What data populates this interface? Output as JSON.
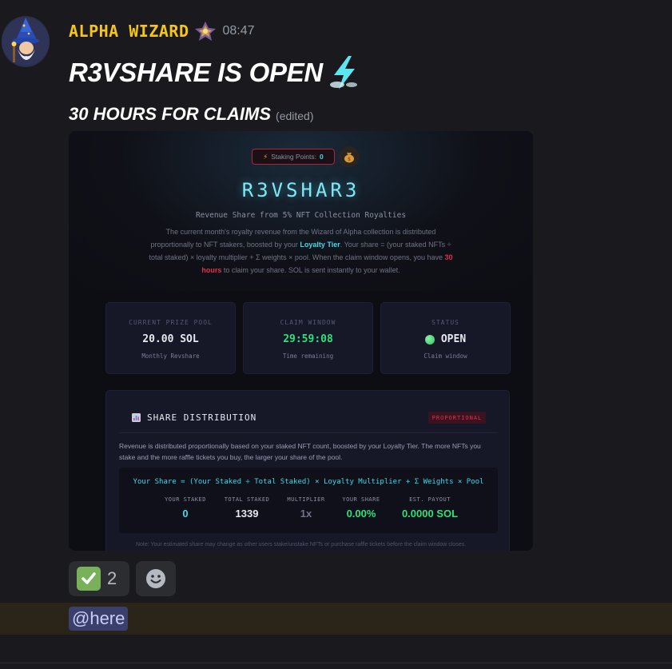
{
  "message": {
    "username": "ALPHA WIZARD",
    "timestamp": "08:47",
    "title": "R3VSHARE IS OPEN",
    "subtitle": "30 HOURS FOR CLAIMS",
    "edited_label": "(edited)"
  },
  "embed": {
    "staking_label": "Staking Points:",
    "staking_value": "0",
    "brand": "R3VSHAR3",
    "tagline": "Revenue Share from 5% NFT Collection Royalties",
    "desc_part1": "The current month's royalty revenue from the Wizard of Alpha collection is distributed proportionally to NFT stakers, boosted by your ",
    "desc_loyalty": "Loyalty Tier",
    "desc_part2": ". Your share = (your staked NFTs ÷ total staked) × loyalty multiplier + Σ weights × pool. When the claim window opens, you have ",
    "desc_hours": "30 hours",
    "desc_part3": " to claim your share. SOL is sent instantly to your wallet.",
    "stats": [
      {
        "label": "CURRENT PRIZE POOL",
        "value": "20.00 SOL",
        "sub": "Monthly Revshare"
      },
      {
        "label": "CLAIM WINDOW",
        "value": "29:59:08",
        "sub": "Time remaining"
      },
      {
        "label": "STATUS",
        "value": "OPEN",
        "sub": "Claim window"
      }
    ],
    "distribution": {
      "title": "SHARE DISTRIBUTION",
      "badge": "PROPORTIONAL",
      "text": "Revenue is distributed proportionally based on your staked NFT count, boosted by your Loyalty Tier. The more NFTs you stake and the more raffle tickets you buy, the larger your share of the pool.",
      "formula": "Your Share = (Your Staked ÷ Total Staked) × Loyalty Multiplier + Σ Weights × Pool",
      "columns": [
        {
          "label": "YOUR STAKED",
          "value": "0",
          "color": "#3fd9e8"
        },
        {
          "label": "TOTAL STAKED",
          "value": "1339",
          "color": "#e6e8f0"
        },
        {
          "label": "MULTIPLIER",
          "value": "1x",
          "color": "#6f7386"
        },
        {
          "label": "YOUR SHARE",
          "value": "0.00%",
          "color": "#2ee27a"
        },
        {
          "label": "EST. PAYOUT",
          "value": "0.0000 SOL",
          "color": "#2ee27a"
        }
      ]
    },
    "note": "Note: Your estimated share may change as other users stake/unstake NFTs or purchase raffle tickets before the claim window closes."
  },
  "reactions": [
    {
      "icon": "check-mark-icon",
      "count": "2"
    }
  ],
  "mention": "@here",
  "colors": {
    "username": "#f5c518",
    "accent_cyan": "#3fd9e8",
    "accent_green": "#2ee27a",
    "accent_red": "#e0304a"
  }
}
